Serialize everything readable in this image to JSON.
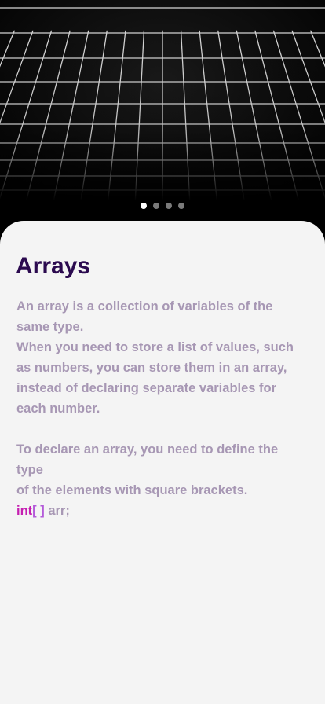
{
  "hero": {
    "image": "perspective-grid-icon"
  },
  "pager": {
    "count": 4,
    "active_index": 0
  },
  "lesson": {
    "title": "Arrays",
    "paragraph1_line1": "An array is a collection of variables of the",
    "paragraph1_line2": "same type.",
    "paragraph2_line1": "When you need to store a list of values, such",
    "paragraph2_line2": "as numbers, you can store them in an array,",
    "paragraph2_line3": "instead of declaring separate variables for",
    "paragraph2_line4": "each number.",
    "paragraph3_line1": "To declare an array, you need to define the type",
    "paragraph3_line2": "of the elements with square brackets.",
    "code": {
      "keyword": "int",
      "brackets": "[ ]",
      "rest": " arr;"
    }
  },
  "colors": {
    "title": "#2b0a4f",
    "body": "#a797b4",
    "keyword": "#c51fb1",
    "card": "#f4f4f4"
  }
}
